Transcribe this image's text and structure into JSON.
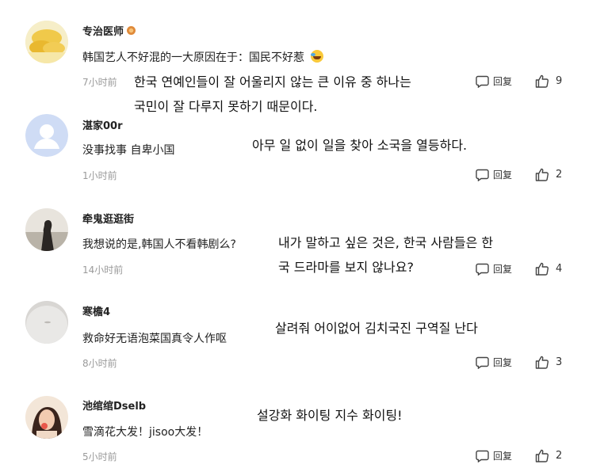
{
  "reply_label": "回复",
  "comments": [
    {
      "username": "专治医师",
      "text": "韩国艺人不好混的一大原因在于：国民不好惹",
      "time": "7小时前",
      "likes": "9",
      "annotation": [
        "한국 연예인들이 잘 어울리지 않는 큰 이유 중 하나는",
        "국민이 잘 다루지 못하기 때문이다."
      ]
    },
    {
      "username": "湛家00r",
      "text": "没事找事 自卑小国",
      "time": "1小时前",
      "likes": "2",
      "annotation": [
        "아무 일 없이 일을 찾아 소국을 열등하다."
      ]
    },
    {
      "username": "牵鬼逛逛街",
      "text": "我想说的是,韩国人不看韩剧么?",
      "time": "14小时前",
      "likes": "4",
      "annotation": [
        "내가 말하고 싶은 것은, 한국 사람들은 한",
        "국 드라마를 보지 않나요?"
      ]
    },
    {
      "username": "寒檐4",
      "text": "救命好无语泡菜国真令人作呕",
      "time": "8小时前",
      "likes": "3",
      "annotation": [
        "살려줘 어이없어 김치국진 구역질 난다"
      ]
    },
    {
      "username": "池绾绾Dselb",
      "text": "雪滴花大发！jisoo大发！",
      "time": "5小时前",
      "likes": "2",
      "annotation": [
        "설강화 화이팅 지수 화이팅!"
      ]
    }
  ]
}
